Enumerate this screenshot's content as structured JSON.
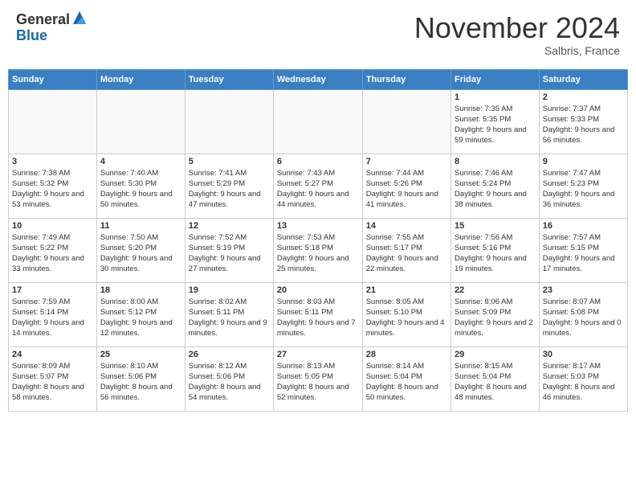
{
  "header": {
    "logo_general": "General",
    "logo_blue": "Blue",
    "month_title": "November 2024",
    "location": "Salbris, France"
  },
  "weekdays": [
    "Sunday",
    "Monday",
    "Tuesday",
    "Wednesday",
    "Thursday",
    "Friday",
    "Saturday"
  ],
  "weeks": [
    [
      {
        "day": "",
        "info": ""
      },
      {
        "day": "",
        "info": ""
      },
      {
        "day": "",
        "info": ""
      },
      {
        "day": "",
        "info": ""
      },
      {
        "day": "",
        "info": ""
      },
      {
        "day": "1",
        "info": "Sunrise: 7:35 AM\nSunset: 5:35 PM\nDaylight: 9 hours and 59 minutes."
      },
      {
        "day": "2",
        "info": "Sunrise: 7:37 AM\nSunset: 5:33 PM\nDaylight: 9 hours and 56 minutes."
      }
    ],
    [
      {
        "day": "3",
        "info": "Sunrise: 7:38 AM\nSunset: 5:32 PM\nDaylight: 9 hours and 53 minutes."
      },
      {
        "day": "4",
        "info": "Sunrise: 7:40 AM\nSunset: 5:30 PM\nDaylight: 9 hours and 50 minutes."
      },
      {
        "day": "5",
        "info": "Sunrise: 7:41 AM\nSunset: 5:29 PM\nDaylight: 9 hours and 47 minutes."
      },
      {
        "day": "6",
        "info": "Sunrise: 7:43 AM\nSunset: 5:27 PM\nDaylight: 9 hours and 44 minutes."
      },
      {
        "day": "7",
        "info": "Sunrise: 7:44 AM\nSunset: 5:26 PM\nDaylight: 9 hours and 41 minutes."
      },
      {
        "day": "8",
        "info": "Sunrise: 7:46 AM\nSunset: 5:24 PM\nDaylight: 9 hours and 38 minutes."
      },
      {
        "day": "9",
        "info": "Sunrise: 7:47 AM\nSunset: 5:23 PM\nDaylight: 9 hours and 36 minutes."
      }
    ],
    [
      {
        "day": "10",
        "info": "Sunrise: 7:49 AM\nSunset: 5:22 PM\nDaylight: 9 hours and 33 minutes."
      },
      {
        "day": "11",
        "info": "Sunrise: 7:50 AM\nSunset: 5:20 PM\nDaylight: 9 hours and 30 minutes."
      },
      {
        "day": "12",
        "info": "Sunrise: 7:52 AM\nSunset: 5:19 PM\nDaylight: 9 hours and 27 minutes."
      },
      {
        "day": "13",
        "info": "Sunrise: 7:53 AM\nSunset: 5:18 PM\nDaylight: 9 hours and 25 minutes."
      },
      {
        "day": "14",
        "info": "Sunrise: 7:55 AM\nSunset: 5:17 PM\nDaylight: 9 hours and 22 minutes."
      },
      {
        "day": "15",
        "info": "Sunrise: 7:56 AM\nSunset: 5:16 PM\nDaylight: 9 hours and 19 minutes."
      },
      {
        "day": "16",
        "info": "Sunrise: 7:57 AM\nSunset: 5:15 PM\nDaylight: 9 hours and 17 minutes."
      }
    ],
    [
      {
        "day": "17",
        "info": "Sunrise: 7:59 AM\nSunset: 5:14 PM\nDaylight: 9 hours and 14 minutes."
      },
      {
        "day": "18",
        "info": "Sunrise: 8:00 AM\nSunset: 5:12 PM\nDaylight: 9 hours and 12 minutes."
      },
      {
        "day": "19",
        "info": "Sunrise: 8:02 AM\nSunset: 5:11 PM\nDaylight: 9 hours and 9 minutes."
      },
      {
        "day": "20",
        "info": "Sunrise: 8:03 AM\nSunset: 5:11 PM\nDaylight: 9 hours and 7 minutes."
      },
      {
        "day": "21",
        "info": "Sunrise: 8:05 AM\nSunset: 5:10 PM\nDaylight: 9 hours and 4 minutes."
      },
      {
        "day": "22",
        "info": "Sunrise: 8:06 AM\nSunset: 5:09 PM\nDaylight: 9 hours and 2 minutes."
      },
      {
        "day": "23",
        "info": "Sunrise: 8:07 AM\nSunset: 5:08 PM\nDaylight: 9 hours and 0 minutes."
      }
    ],
    [
      {
        "day": "24",
        "info": "Sunrise: 8:09 AM\nSunset: 5:07 PM\nDaylight: 8 hours and 58 minutes."
      },
      {
        "day": "25",
        "info": "Sunrise: 8:10 AM\nSunset: 5:06 PM\nDaylight: 8 hours and 56 minutes."
      },
      {
        "day": "26",
        "info": "Sunrise: 8:12 AM\nSunset: 5:06 PM\nDaylight: 8 hours and 54 minutes."
      },
      {
        "day": "27",
        "info": "Sunrise: 8:13 AM\nSunset: 5:05 PM\nDaylight: 8 hours and 52 minutes."
      },
      {
        "day": "28",
        "info": "Sunrise: 8:14 AM\nSunset: 5:04 PM\nDaylight: 8 hours and 50 minutes."
      },
      {
        "day": "29",
        "info": "Sunrise: 8:15 AM\nSunset: 5:04 PM\nDaylight: 8 hours and 48 minutes."
      },
      {
        "day": "30",
        "info": "Sunrise: 8:17 AM\nSunset: 5:03 PM\nDaylight: 8 hours and 46 minutes."
      }
    ]
  ]
}
